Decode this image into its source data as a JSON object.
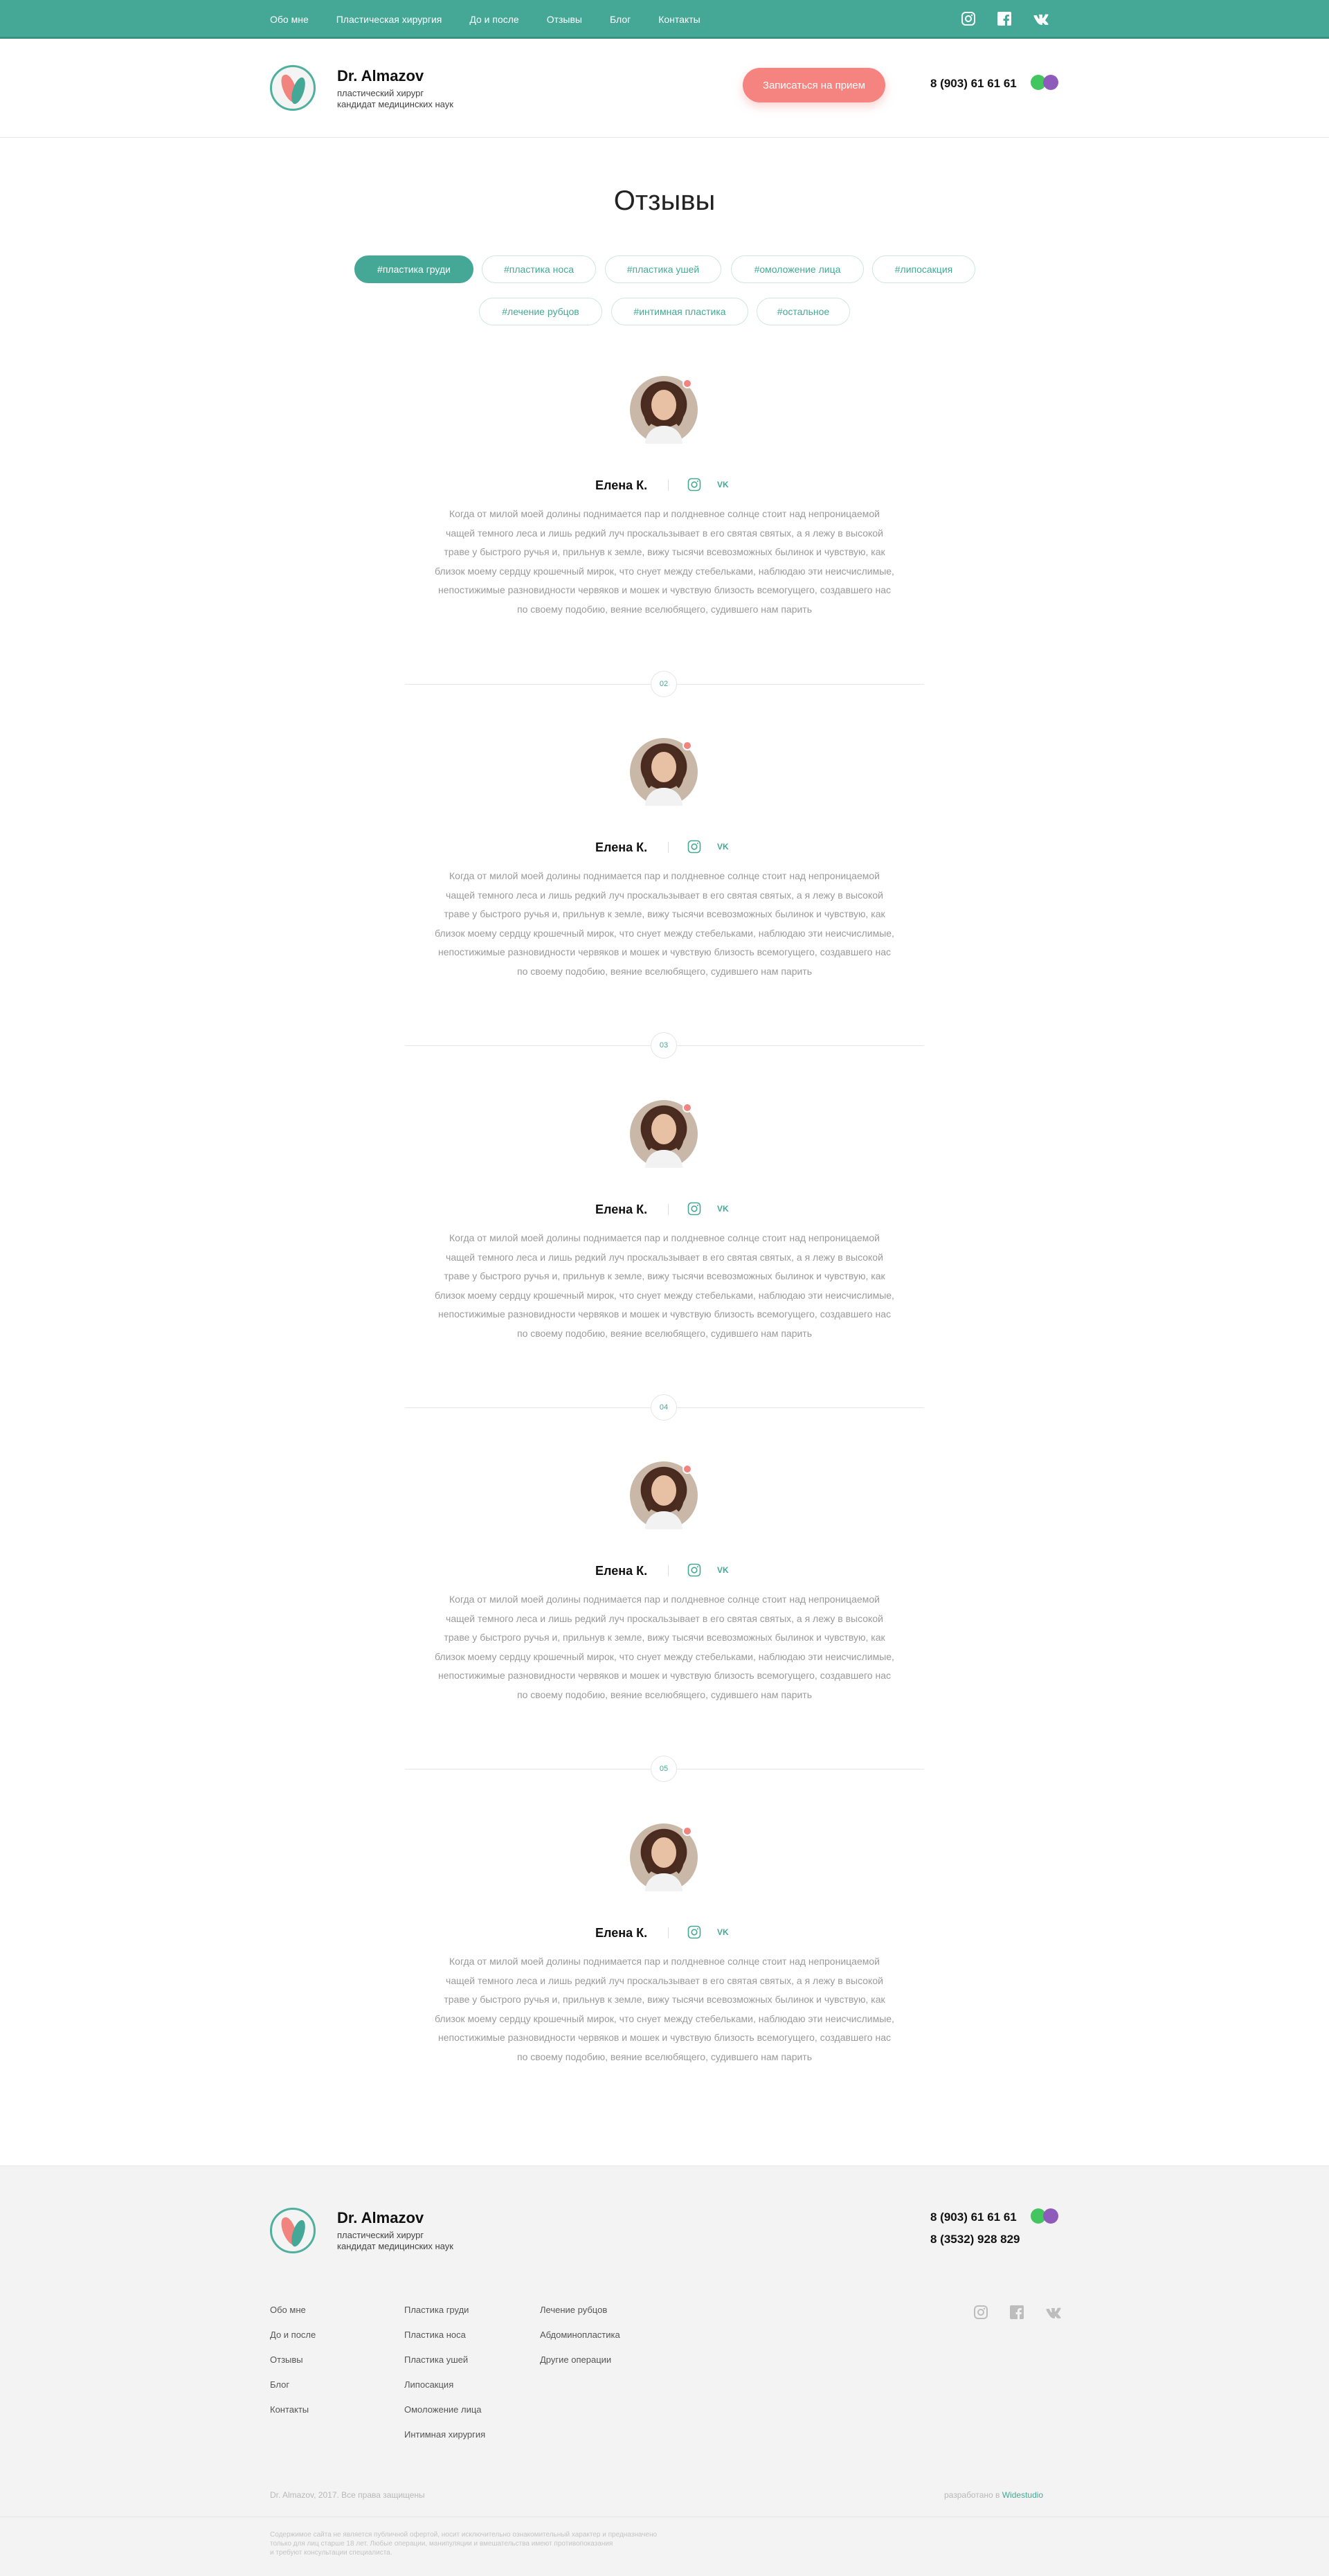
{
  "nav": {
    "items": [
      "Обо мне",
      "Пластическая хирургия",
      "До и после",
      "Отзывы",
      "Блог",
      "Контакты"
    ],
    "social_icons": [
      "instagram-icon",
      "facebook-icon",
      "vk-icon"
    ]
  },
  "header": {
    "brand_name": "Dr. Almazov",
    "brand_sub_line1": "пластический хирург",
    "brand_sub_line2": "кандидат медицинских наук",
    "cta_label": "Записаться на прием",
    "phone": "8 (903) 61 61 61"
  },
  "page": {
    "title": "Отзывы",
    "tags": [
      "#пластика груди",
      "#пластика носа",
      "#пластика ушей",
      "#омоложение лица",
      "#липосакция",
      "#лечение рубцов",
      "#интимная пластика",
      "#остальное"
    ],
    "active_tag": "#пластика груди"
  },
  "reviews": [
    {
      "name": "Елена К.",
      "vk_label": "VK",
      "lines": [
        "Когда от милой моей долины поднимается пар и полдневное солнце стоит над непроницаемой",
        "чащей темного леса и лишь редкий луч проскальзывает в его святая святых, а я лежу в высокой",
        "траве у быстрого ручья и, прильнув к земле, вижу тысячи всевозможных былинок и чувствую, как",
        "близок моему сердцу крошечный мирок, что снует между стебельками, наблюдаю эти неисчислимые,",
        "непостижимые разновидности червяков и мошек и чувствую близость всемогущего, создавшего нас",
        "по своему подобию, веяние вселюбящего, судившего нам парить"
      ]
    },
    {
      "name": "Елена К.",
      "vk_label": "VK",
      "lines": [
        "Когда от милой моей долины поднимается пар и полдневное солнце стоит над непроницаемой",
        "чащей темного леса и лишь редкий луч проскальзывает в его святая святых, а я лежу в высокой",
        "траве у быстрого ручья и, прильнув к земле, вижу тысячи всевозможных былинок и чувствую, как",
        "близок моему сердцу крошечный мирок, что снует между стебельками, наблюдаю эти неисчислимые,",
        "непостижимые разновидности червяков и мошек и чувствую близость всемогущего, создавшего нас",
        "по своему подобию, веяние вселюбящего, судившего нам парить"
      ]
    },
    {
      "name": "Елена К.",
      "vk_label": "VK",
      "lines": [
        "Когда от милой моей долины поднимается пар и полдневное солнце стоит над непроницаемой",
        "чащей темного леса и лишь редкий луч проскальзывает в его святая святых, а я лежу в высокой",
        "траве у быстрого ручья и, прильнув к земле, вижу тысячи всевозможных былинок и чувствую, как",
        "близок моему сердцу крошечный мирок, что снует между стебельками, наблюдаю эти неисчислимые,",
        "непостижимые разновидности червяков и мошек и чувствую близость всемогущего, создавшего нас",
        "по своему подобию, веяние вселюбящего, судившего нам парить"
      ]
    },
    {
      "name": "Елена К.",
      "vk_label": "VK",
      "lines": [
        "Когда от милой моей долины поднимается пар и полдневное солнце стоит над непроницаемой",
        "чащей темного леса и лишь редкий луч проскальзывает в его святая святых, а я лежу в высокой",
        "траве у быстрого ручья и, прильнув к земле, вижу тысячи всевозможных былинок и чувствую, как",
        "близок моему сердцу крошечный мирок, что снует между стебельками, наблюдаю эти неисчислимые,",
        "непостижимые разновидности червяков и мошек и чувствую близость всемогущего, создавшего нас",
        "по своему подобию, веяние вселюбящего, судившего нам парить"
      ]
    },
    {
      "name": "Елена К.",
      "vk_label": "VK",
      "lines": [
        "Когда от милой моей долины поднимается пар и полдневное солнце стоит над непроницаемой",
        "чащей темного леса и лишь редкий луч проскальзывает в его святая святых, а я лежу в высокой",
        "траве у быстрого ручья и, прильнув к земле, вижу тысячи всевозможных былинок и чувствую, как",
        "близок моему сердцу крошечный мирок, что снует между стебельками, наблюдаю эти неисчислимые,",
        "непостижимые разновидности червяков и мошек и чувствую близость всемогущего, создавшего нас",
        "по своему подобию, веяние вселюбящего, судившего нам парить"
      ]
    }
  ],
  "separators": [
    "02",
    "03",
    "04",
    "05"
  ],
  "footer": {
    "brand_name": "Dr. Almazov",
    "brand_sub_line1": "пластический хирург",
    "brand_sub_line2": "кандидат медицинских наук",
    "phone1": "8 (903) 61 61 61",
    "phone2": "8 (3532) 928 829",
    "col1": [
      "Обо мне",
      "До и после",
      "Отзывы",
      "Блог",
      "Контакты"
    ],
    "col2": [
      "Пластика груди",
      "Пластика носа",
      "Пластика ушей",
      "Липосакция",
      "Омоложение лица",
      "Интимная хирургия"
    ],
    "col3": [
      "Лечение рубцов",
      "Абдоминопластика",
      "Другие операции"
    ],
    "copyright": "Dr. Almazov, 2017. Все права защищены",
    "dev_prefix": "разработано в",
    "dev_studio": "Widestudio",
    "disclaimer_lines": [
      "Содержимое сайта не является публичной офертой, носит исключительно ознакомительный характер и предназначено",
      "только для лиц старше 18 лет. Любые операции, манипуляции и вмешательства имеют противопоказания",
      "и требуют консультации специалиста."
    ]
  },
  "colors": {
    "accent": "#45a896",
    "cta": "#f5837f",
    "whatsapp": "#43c55f",
    "viber": "#8e5bbb"
  }
}
